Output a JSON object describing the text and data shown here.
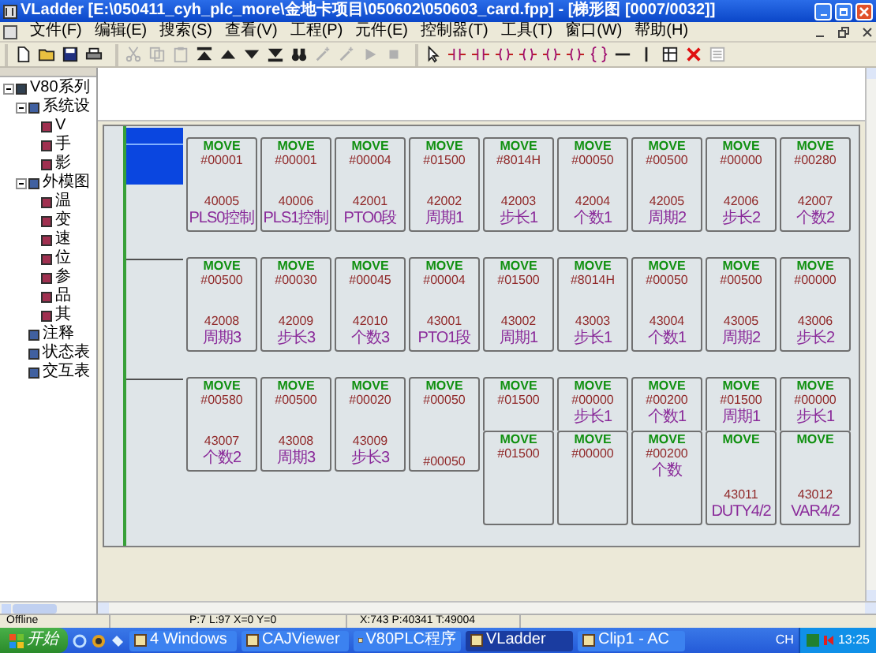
{
  "window": {
    "title": "VLadder [E:\\050411_cyh_plc_more\\金地卡项目\\050602\\050603_card.fpp] - [梯形图 [0007/0032]]"
  },
  "menu": [
    "文件(F)",
    "编辑(E)",
    "搜索(S)",
    "查看(V)",
    "工程(P)",
    "元件(E)",
    "控制器(T)",
    "工具(T)",
    "窗口(W)",
    "帮助(H)"
  ],
  "toolbar": [
    [
      {
        "disabled": false
      },
      {
        "disabled": false
      },
      {
        "disabled": false
      },
      {
        "disabled": false
      }
    ],
    [
      {
        "disabled": true
      },
      {
        "disabled": true
      },
      {
        "disabled": true
      },
      {
        "disabled": false
      },
      {
        "disabled": false
      },
      {
        "disabled": false
      },
      {
        "disabled": false
      },
      {
        "disabled": false
      },
      {
        "disabled": true
      },
      {
        "disabled": true
      },
      {
        "disabled": true
      },
      {
        "disabled": true
      }
    ],
    [
      {
        "disabled": false
      },
      {
        "disabled": false
      },
      {
        "disabled": false
      },
      {
        "disabled": false
      },
      {
        "disabled": false
      },
      {
        "disabled": false
      },
      {
        "disabled": false
      },
      {
        "disabled": false
      },
      {
        "disabled": false
      },
      {
        "disabled": false
      },
      {
        "disabled": false
      },
      {
        "disabled": false
      },
      {
        "disabled": true
      }
    ]
  ],
  "tree": [
    {
      "label": "V80系列",
      "expanded": true,
      "children": [
        {
          "label": "系统设",
          "expanded": true,
          "children": [
            {
              "label": "V"
            },
            {
              "label": "手"
            },
            {
              "label": "影"
            }
          ]
        },
        {
          "label": "外模图",
          "expanded": true,
          "children": [
            {
              "label": "温"
            },
            {
              "label": "变"
            },
            {
              "label": "速"
            },
            {
              "label": "位"
            },
            {
              "label": "参"
            },
            {
              "label": "品"
            },
            {
              "label": "其"
            }
          ]
        },
        {
          "label": "注释"
        },
        {
          "label": "状态表"
        },
        {
          "label": "交互表"
        }
      ]
    }
  ],
  "rungs": [
    {
      "selected": true,
      "blocks": [
        {
          "header": "MOVE",
          "value": "#00001",
          "address": "40005",
          "label": "PLS0控制"
        },
        {
          "header": "MOVE",
          "value": "#00001",
          "address": "40006",
          "label": "PLS1控制"
        },
        {
          "header": "MOVE",
          "value": "#00004",
          "address": "42001",
          "label": "PTO0段"
        },
        {
          "header": "MOVE",
          "value": "#01500",
          "address": "42002",
          "label": "周期1"
        },
        {
          "header": "MOVE",
          "value": "#8014H",
          "address": "42003",
          "label": "步长1"
        },
        {
          "header": "MOVE",
          "value": "#00050",
          "address": "42004",
          "label": "个数1"
        },
        {
          "header": "MOVE",
          "value": "#00500",
          "address": "42005",
          "label": "周期2"
        },
        {
          "header": "MOVE",
          "value": "#00000",
          "address": "42006",
          "label": "步长2"
        },
        {
          "header": "MOVE",
          "value": "#00280",
          "address": "42007",
          "label": "个数2"
        }
      ]
    },
    {
      "selected": false,
      "blocks": [
        {
          "header": "MOVE",
          "value": "#00500",
          "address": "42008",
          "label": "周期3"
        },
        {
          "header": "MOVE",
          "value": "#00030",
          "address": "42009",
          "label": "步长3"
        },
        {
          "header": "MOVE",
          "value": "#00045",
          "address": "42010",
          "label": "个数3"
        },
        {
          "header": "MOVE",
          "value": "#00004",
          "address": "43001",
          "label": "PTO1段"
        },
        {
          "header": "MOVE",
          "value": "#01500",
          "address": "43002",
          "label": "周期1"
        },
        {
          "header": "MOVE",
          "value": "#8014H",
          "address": "43003",
          "label": "步长1"
        },
        {
          "header": "MOVE",
          "value": "#00050",
          "address": "43004",
          "label": "个数1"
        },
        {
          "header": "MOVE",
          "value": "#00500",
          "address": "43005",
          "label": "周期2"
        },
        {
          "header": "MOVE",
          "value": "#00000",
          "address": "43006",
          "label": "步长2"
        }
      ]
    },
    {
      "selected": false,
      "blocks": [
        {
          "header": "MOVE",
          "value": "#00580",
          "address": "43007",
          "label": "个数2"
        },
        {
          "header": "MOVE",
          "value": "#00500",
          "address": "43008",
          "label": "周期3"
        },
        {
          "header": "MOVE",
          "value": "#00020",
          "address": "43009",
          "label": "步长3"
        },
        {
          "header": "MOVE",
          "value": "#00050",
          "address": "#00050"
        },
        {
          "header": "MOVE",
          "value": "#01500",
          "kind": "cut"
        },
        {
          "header": "MOVE",
          "value": "#00000",
          "note": "步长1",
          "kind": "cut"
        },
        {
          "header": "MOVE",
          "value": "#00200",
          "note": "个数1",
          "kind": "cut"
        },
        {
          "header": "MOVE",
          "value": "#01500",
          "note": "周期1",
          "kind": "cut"
        },
        {
          "header": "MOVE",
          "value": "#00000",
          "note": "步长1",
          "kind": "cut"
        }
      ],
      "overlay_blocks": [
        {
          "header": "MOVE",
          "value": "#01500"
        },
        {
          "header": "MOVE",
          "value": "#00000"
        },
        {
          "header": "MOVE",
          "value": "#00200",
          "note": "个数"
        },
        {
          "header": "MOVE",
          "address": "43011",
          "label": "DUTY4/2"
        },
        {
          "header": "MOVE",
          "address": "43012",
          "label": "VAR4/2"
        }
      ]
    }
  ],
  "status_bar": [
    "Offline",
    "P:7 L:97 X=0 Y=0",
    "X:743 P:40341 T:49004"
  ],
  "taskbar": {
    "start": "开始",
    "tasks": [
      {
        "label": "4 Windows",
        "selected": false
      },
      {
        "label": "CAJViewer",
        "selected": false
      },
      {
        "label": "V80PLC程序",
        "selected": false
      },
      {
        "label": "VLadder",
        "selected": true
      },
      {
        "label": "Clip1 - AC",
        "selected": false
      }
    ],
    "language": "CH",
    "clock": "13:25"
  }
}
